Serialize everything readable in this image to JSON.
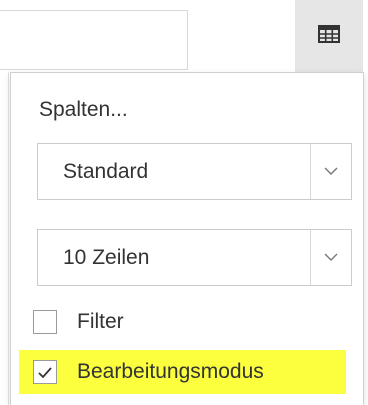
{
  "toolbar": {
    "search": {
      "value": "",
      "placeholder": ""
    },
    "grid_button_icon": "table-grid-icon"
  },
  "dropdown": {
    "columns_link": "Spalten...",
    "view_select": {
      "selected": "Standard",
      "icon": "chevron-down-icon"
    },
    "rows_select": {
      "selected": "10 Zeilen",
      "icon": "chevron-down-icon"
    },
    "filter": {
      "label": "Filter",
      "checked": false
    },
    "edit_mode": {
      "label": "Bearbeitungsmodus",
      "checked": true,
      "highlight_color": "#fbff3d"
    }
  },
  "colors": {
    "text": "#333333",
    "button_bg": "#e6e6e6",
    "border": "#cccccc"
  }
}
